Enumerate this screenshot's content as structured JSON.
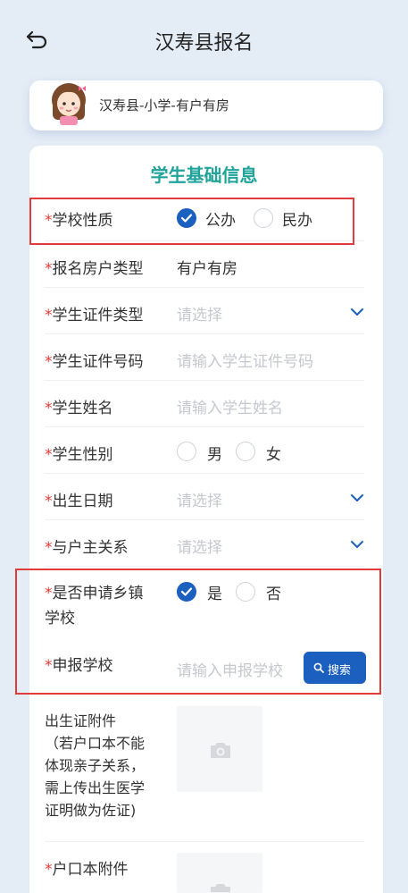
{
  "header": {
    "title": "汉寿县报名"
  },
  "user_card": {
    "info": "汉寿县-小学-有户有房"
  },
  "section": {
    "title": "学生基础信息"
  },
  "required_mark": "*",
  "fields": {
    "school_type": {
      "label": "学校性质",
      "options": [
        "公办",
        "民办"
      ],
      "selected": "公办"
    },
    "household_type": {
      "label": "报名房户类型",
      "value": "有户有房"
    },
    "id_type": {
      "label": "学生证件类型",
      "placeholder": "请选择"
    },
    "id_number": {
      "label": "学生证件号码",
      "placeholder": "请输入学生证件号码"
    },
    "name": {
      "label": "学生姓名",
      "placeholder": "请输入学生姓名"
    },
    "gender": {
      "label": "学生性别",
      "options": [
        "男",
        "女"
      ]
    },
    "birth_date": {
      "label": "出生日期",
      "placeholder": "请选择"
    },
    "relation": {
      "label": "与户主关系",
      "placeholder": "请选择"
    },
    "rural_school": {
      "label_line1": "是否申请乡镇",
      "label_line2": "学校",
      "options": [
        "是",
        "否"
      ],
      "selected": "是"
    },
    "apply_school": {
      "label": "申报学校",
      "placeholder": "请输入申报学校",
      "button": "搜索"
    },
    "birth_cert": {
      "label_lines": [
        "出生证附件",
        "（若户口本不能",
        "体现亲子关系，",
        "需上传出生医学",
        "证明做为佐证)"
      ]
    },
    "hukou": {
      "label": "户口本附件"
    }
  },
  "colors": {
    "accent": "#1b5fbf",
    "section_title": "#1fa39a",
    "required": "#e53935",
    "highlight": "#e23b3b"
  }
}
